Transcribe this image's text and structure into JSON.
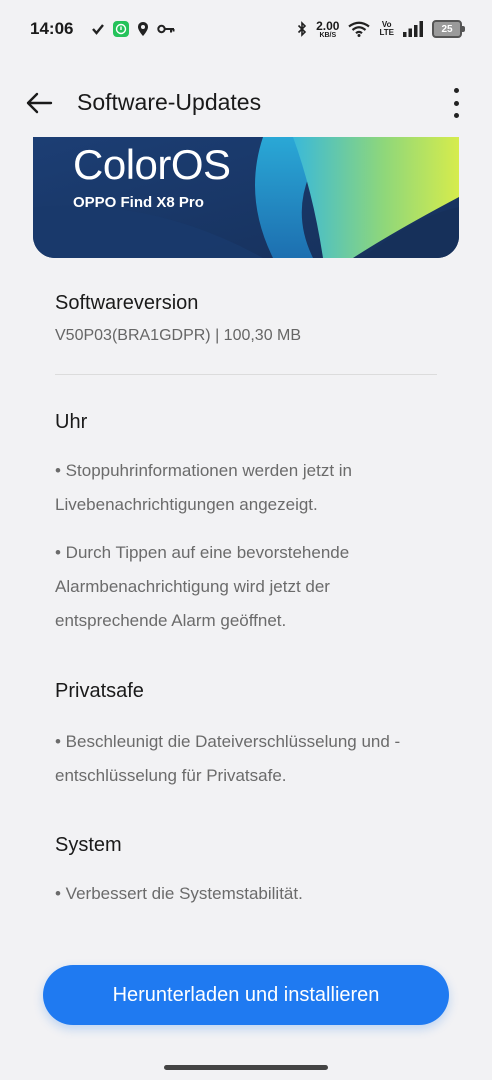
{
  "status_bar": {
    "time": "14:06",
    "net_speed_value": "2.00",
    "net_speed_unit": "KB/S",
    "volte_top": "Vo",
    "volte_bottom": "LTE",
    "battery": "25",
    "icons": [
      "check-icon",
      "whatsapp-icon",
      "location-icon",
      "key-icon",
      "bluetooth-icon",
      "wifi-icon",
      "signal-icon",
      "battery-icon"
    ]
  },
  "app_bar": {
    "title": "Software-Updates",
    "back_icon": "arrow-left-icon",
    "more_icon": "more-vertical-icon"
  },
  "banner": {
    "logo": "ColorOS",
    "model": "OPPO Find X8 Pro",
    "colors": [
      "#18325e",
      "#2fb4d8",
      "#c8e84a"
    ]
  },
  "version": {
    "title": "Softwareversion",
    "detail": "V50P03(BRA1GDPR) | 100,30 MB"
  },
  "sections": [
    {
      "title": "Uhr",
      "bullets": [
        "• Stoppuhrinformationen werden jetzt in Livebenachrichtigungen angezeigt.",
        "• Durch Tippen auf eine bevorstehende Alarmbenachrichtigung wird jetzt der entsprechende Alarm geöffnet."
      ]
    },
    {
      "title": "Privatsafe",
      "bullets": [
        "• Beschleunigt die Dateiverschlüsselung und -entschlüsselung für Privatsafe."
      ]
    },
    {
      "title": "System",
      "bullets": [
        "• Verbessert die Systemstabilität."
      ]
    }
  ],
  "install_button": {
    "label": "Herunterladen und installieren",
    "color": "#1f7af1"
  }
}
